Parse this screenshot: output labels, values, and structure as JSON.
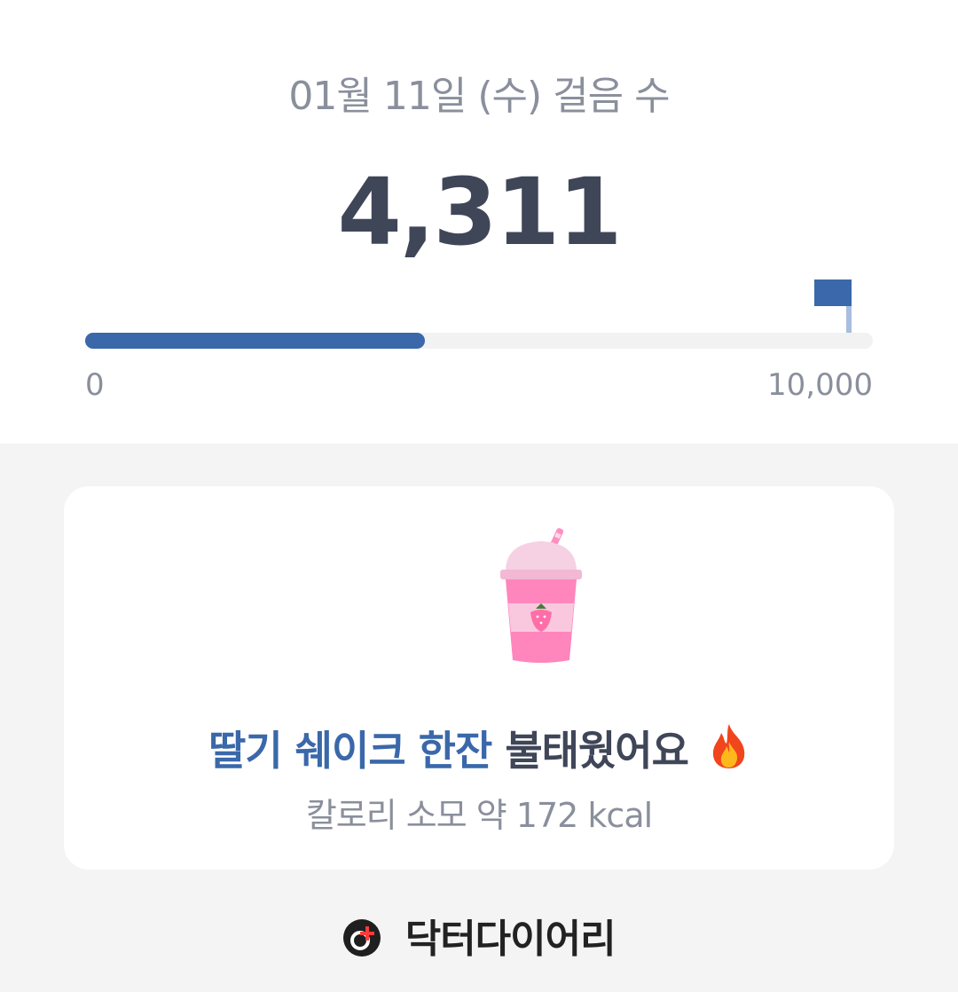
{
  "header": {
    "date_title": "01월 11일 (수) 걸음 수",
    "steps": "4,311"
  },
  "progress": {
    "value": 4311,
    "goal": 10000,
    "fraction": 0.4311,
    "min_label": "0",
    "max_label": "10,000",
    "accent_color": "#3a68aa"
  },
  "card": {
    "image_icon": "strawberry-shake-icon",
    "headline_accent": "딸기 쉐이크 한잔",
    "headline_rest": "불태웠어요",
    "headline_emoji_icon": "fire-icon",
    "subtitle": "칼로리 소모 약 172 kcal"
  },
  "footer": {
    "brand_icon": "doctor-diary-logo-icon",
    "brand_name": "닥터다이어리"
  }
}
